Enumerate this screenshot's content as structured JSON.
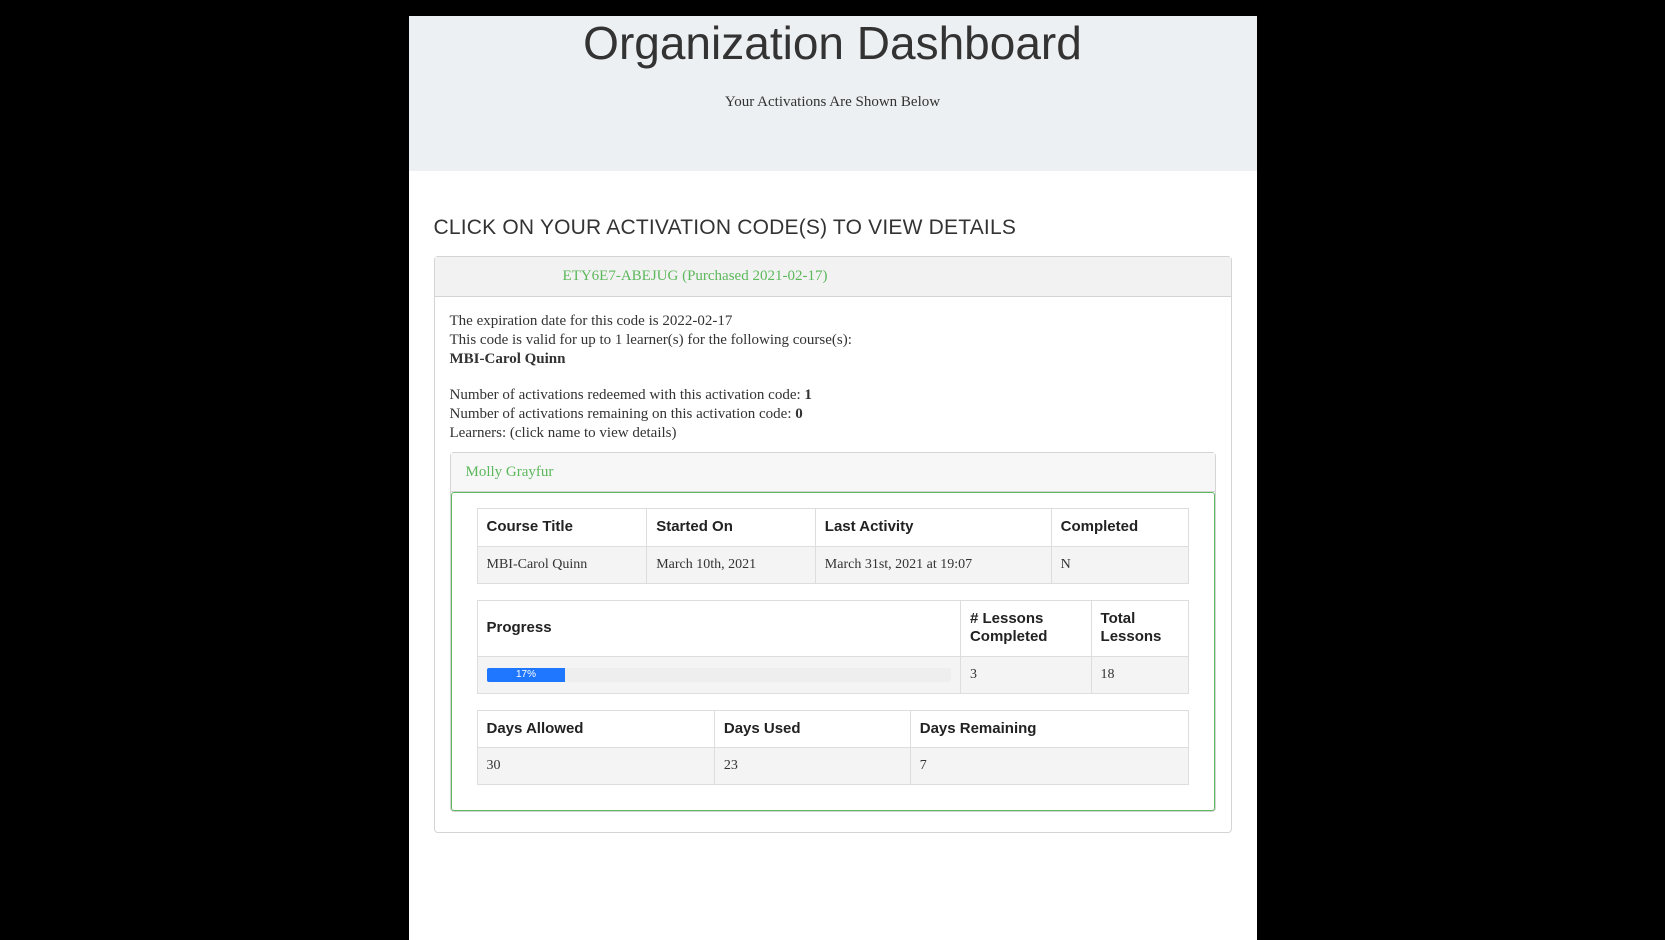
{
  "header": {
    "title": "Organization Dashboard",
    "subtitle": "Your Activations Are Shown Below"
  },
  "section_heading": "CLICK ON YOUR ACTIVATION CODE(S) TO VIEW DETAILS",
  "activation": {
    "code_label": "ETY6E7-ABEJUG (Purchased 2021-02-17)",
    "expiration_text": "The expiration date for this code is 2022-02-17",
    "valid_text": "This code is valid for up to 1 learner(s) for the following course(s):",
    "course_name": "MBI-Carol Quinn",
    "redeemed_label": "Number of activations redeemed with this activation code: ",
    "redeemed_value": "1",
    "remaining_label": "Number of activations remaining on this activation code: ",
    "remaining_value": "0",
    "learners_label": "Learners: (click name to view details)"
  },
  "learner": {
    "name": "Molly Grayfur",
    "table1": {
      "headers": {
        "c1": "Course Title",
        "c2": "Started On",
        "c3": "Last Activity",
        "c4": "Completed"
      },
      "row": {
        "c1": "MBI-Carol Quinn",
        "c2": "March 10th, 2021",
        "c3": "March 31st, 2021 at 19:07",
        "c4": "N"
      }
    },
    "table2": {
      "headers": {
        "c1": "Progress",
        "c2": "# Lessons Completed",
        "c3": "Total Lessons"
      },
      "row": {
        "progress_pct": "17%",
        "progress_width": "17%",
        "c2": "3",
        "c3": "18"
      }
    },
    "table3": {
      "headers": {
        "c1": "Days Allowed",
        "c2": "Days Used",
        "c3": "Days Remaining"
      },
      "row": {
        "c1": "30",
        "c2": "23",
        "c3": "7"
      }
    }
  }
}
